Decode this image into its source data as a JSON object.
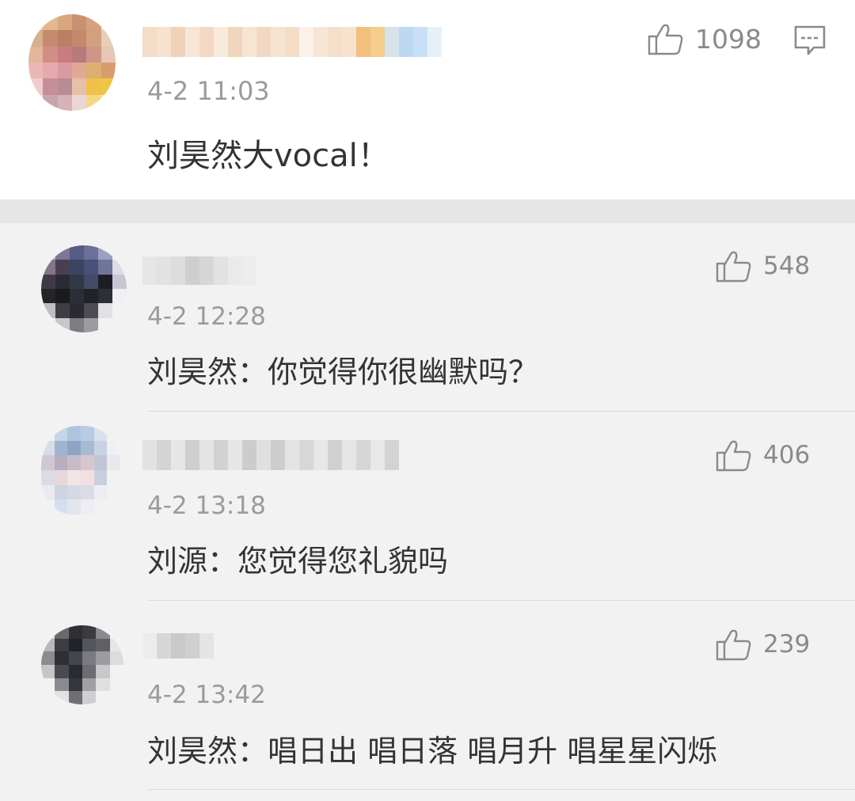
{
  "main_comment": {
    "time": "4-2 11:03",
    "likes": "1098",
    "content": "刘昊然大vocal！",
    "icons": {
      "like": "thumbs-up-icon",
      "reply": "comment-icon"
    }
  },
  "replies": [
    {
      "time": "4-2 12:28",
      "likes": "548",
      "content": "刘昊然：你觉得你很幽默吗？"
    },
    {
      "time": "4-2 13:18",
      "likes": "406",
      "content": "刘源：您觉得您礼貌吗"
    },
    {
      "time": "4-2 13:42",
      "likes": "239",
      "content": "刘昊然：唱日出 唱日落 唱月升 唱星星闪烁"
    }
  ],
  "colors": {
    "text_primary": "#333333",
    "text_secondary": "#9b9b9b",
    "icon": "#8a8a8a",
    "main_bg": "#ffffff",
    "reply_bg": "#f2f2f2"
  }
}
